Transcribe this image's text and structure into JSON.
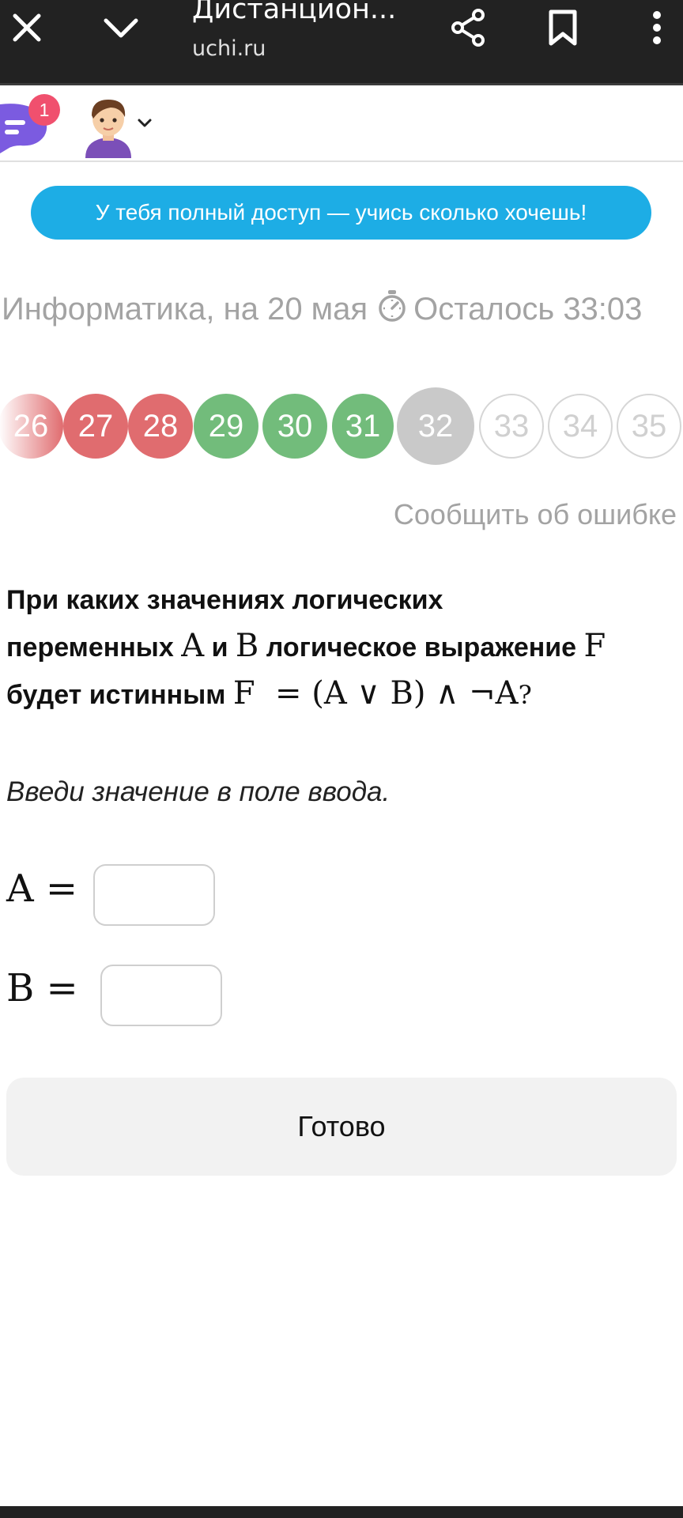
{
  "browser": {
    "title": "Дистанцион...",
    "url": "uchi.ru",
    "icons": [
      "close-icon",
      "chevron-down-icon",
      "share-icon",
      "bookmark-icon",
      "more-vert-icon"
    ]
  },
  "header": {
    "chat_badge": "1",
    "icons": [
      "chat-icon",
      "avatar",
      "chevron-down-icon"
    ]
  },
  "banner": {
    "text": "У тебя полный доступ — учись сколько хочешь!"
  },
  "subject": {
    "title": "Информатика, на 20 мая",
    "timer": "Осталось 33:03"
  },
  "question_nav": {
    "items": [
      {
        "label": "26",
        "status": "wrong"
      },
      {
        "label": "27",
        "status": "wrong"
      },
      {
        "label": "28",
        "status": "wrong"
      },
      {
        "label": "29",
        "status": "correct"
      },
      {
        "label": "30",
        "status": "correct"
      },
      {
        "label": "31",
        "status": "correct"
      },
      {
        "label": "32",
        "status": "current"
      },
      {
        "label": "33",
        "status": "unanswered"
      },
      {
        "label": "34",
        "status": "unanswered"
      },
      {
        "label": "35",
        "status": "unanswered"
      }
    ]
  },
  "report_link": "Сообщить об ошибке",
  "question": {
    "line1": "При каких значениях логических",
    "line2_a": "переменных",
    "var_a": "A",
    "line2_b": "и",
    "var_b": "B",
    "line2_c": "логическое выражение",
    "var_f": "F",
    "line3_a": "будет истинным",
    "formula": "F  = (A ∨ B) ∧ ¬A",
    "qmark": "?"
  },
  "hint": "Введи значение в поле ввода.",
  "inputs": {
    "a_label": "A =",
    "a_value": "",
    "b_label": "B =",
    "b_value": ""
  },
  "done_button": "Готово",
  "colors": {
    "topbar": "#222222",
    "banner": "#1dade5",
    "wrong": "#e06c6f",
    "correct": "#72bc7b",
    "current": "#c9c9c9",
    "chat_icon": "#7b5be0",
    "badge": "#f0506e"
  }
}
